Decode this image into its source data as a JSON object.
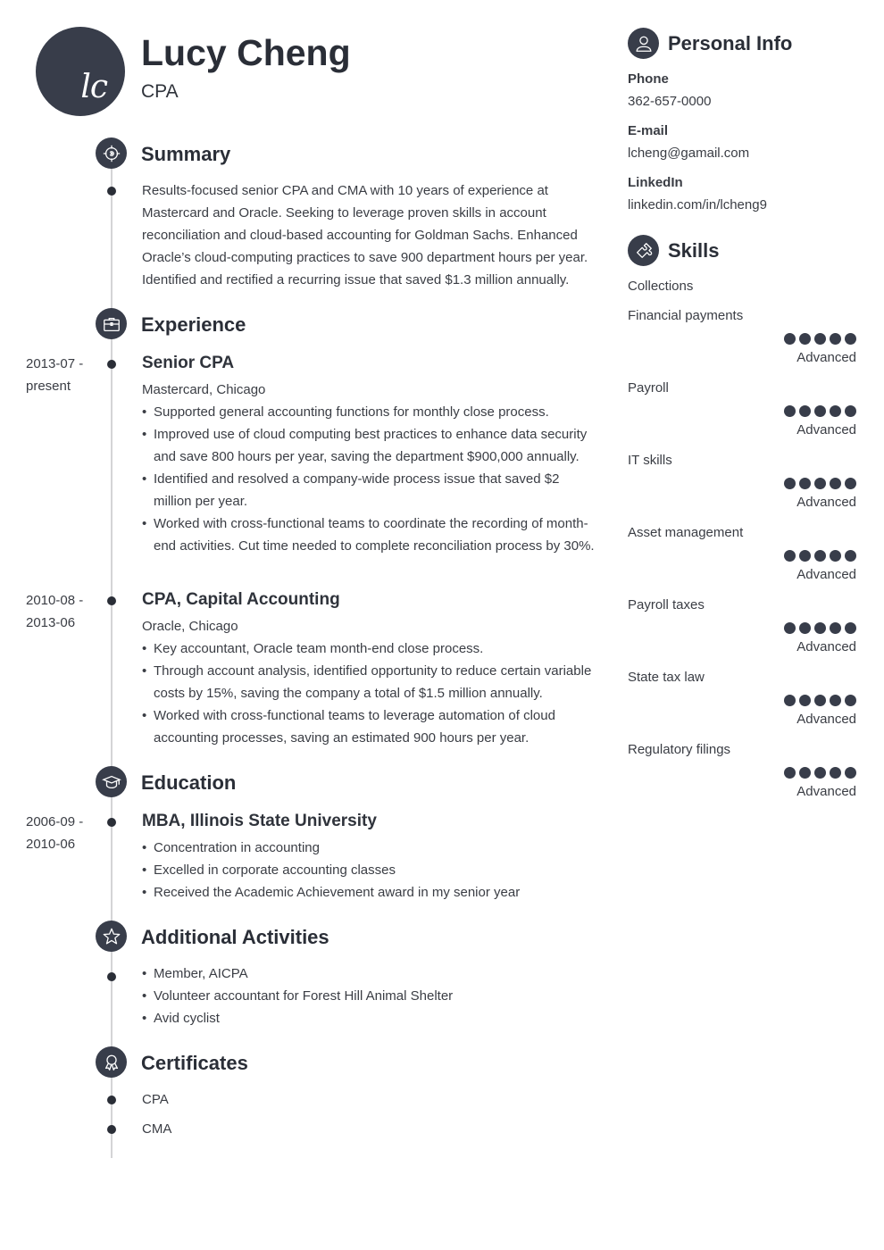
{
  "header": {
    "initials": "lc",
    "name": "Lucy Cheng",
    "title": "CPA"
  },
  "sections": {
    "summary": {
      "title": "Summary",
      "icon": "target-icon",
      "text": "Results-focused senior CPA and CMA with 10 years of experience at Mastercard and Oracle. Seeking to leverage proven skills in account reconciliation and cloud-based accounting for Goldman Sachs. Enhanced Oracle’s cloud-computing practices to save 900 department hours per year. Identified and rectified a recurring issue that saved $1.3 million annually."
    },
    "experience": {
      "title": "Experience",
      "icon": "briefcase-icon",
      "entries": [
        {
          "date_start": "2013-07 -",
          "date_end": "present",
          "title": "Senior CPA",
          "subtitle": "Mastercard, Chicago",
          "bullets": [
            "Supported general accounting functions for monthly close process.",
            "Improved use of cloud computing best practices to enhance data security and save 800 hours per year, saving the department $900,000 annually.",
            "Identified and resolved a company-wide process issue that saved $2 million per year.",
            "Worked with cross-functional teams to coordinate the recording of month-end activities. Cut time needed to complete reconciliation process by 30%."
          ]
        },
        {
          "date_start": "2010-08 -",
          "date_end": "2013-06",
          "title": "CPA, Capital Accounting",
          "subtitle": "Oracle, Chicago",
          "bullets": [
            "Key accountant, Oracle team month-end close process.",
            "Through account analysis, identified opportunity to reduce certain variable costs by 15%, saving the company a total of $1.5 million annually.",
            "Worked with cross-functional teams to leverage automation of cloud accounting processes, saving an estimated 900 hours per year."
          ]
        }
      ]
    },
    "education": {
      "title": "Education",
      "icon": "graduation-cap-icon",
      "entries": [
        {
          "date_start": "2006-09 -",
          "date_end": "2010-06",
          "title": "MBA, Illinois State University",
          "bullets": [
            "Concentration in accounting",
            "Excelled in corporate accounting classes",
            "Received the Academic Achievement award in my senior year"
          ]
        }
      ]
    },
    "activities": {
      "title": "Additional Activities",
      "icon": "star-icon",
      "bullets": [
        "Member, AICPA",
        "Volunteer accountant for Forest Hill Animal Shelter",
        "Avid cyclist"
      ]
    },
    "certificates": {
      "title": "Certificates",
      "icon": "award-ribbon-icon",
      "items": [
        "CPA",
        "CMA"
      ]
    }
  },
  "personal_info": {
    "title": "Personal Info",
    "icon": "user-icon",
    "fields": [
      {
        "label": "Phone",
        "value": "362-657-0000"
      },
      {
        "label": "E-mail",
        "value": "lcheng@gamail.com"
      },
      {
        "label": "LinkedIn",
        "value": "linkedin.com/in/lcheng9"
      }
    ]
  },
  "skills": {
    "title": "Skills",
    "icon": "puzzle-icon",
    "items": [
      {
        "name": "Collections",
        "rating": null,
        "max": 5,
        "level": ""
      },
      {
        "name": "Financial payments",
        "rating": 5,
        "max": 5,
        "level": "Advanced"
      },
      {
        "name": "Payroll",
        "rating": 5,
        "max": 5,
        "level": "Advanced"
      },
      {
        "name": "IT skills",
        "rating": 5,
        "max": 5,
        "level": "Advanced"
      },
      {
        "name": "Asset management",
        "rating": 5,
        "max": 5,
        "level": "Advanced"
      },
      {
        "name": "Payroll taxes",
        "rating": 5,
        "max": 5,
        "level": "Advanced"
      },
      {
        "name": "State tax law",
        "rating": 5,
        "max": 5,
        "level": "Advanced"
      },
      {
        "name": "Regulatory filings",
        "rating": 5,
        "max": 5,
        "level": "Advanced"
      }
    ]
  },
  "colors": {
    "accent": "#383d4a",
    "text": "#3a3d44",
    "heading": "#2a2e37",
    "timeline": "#d4d4d6"
  }
}
